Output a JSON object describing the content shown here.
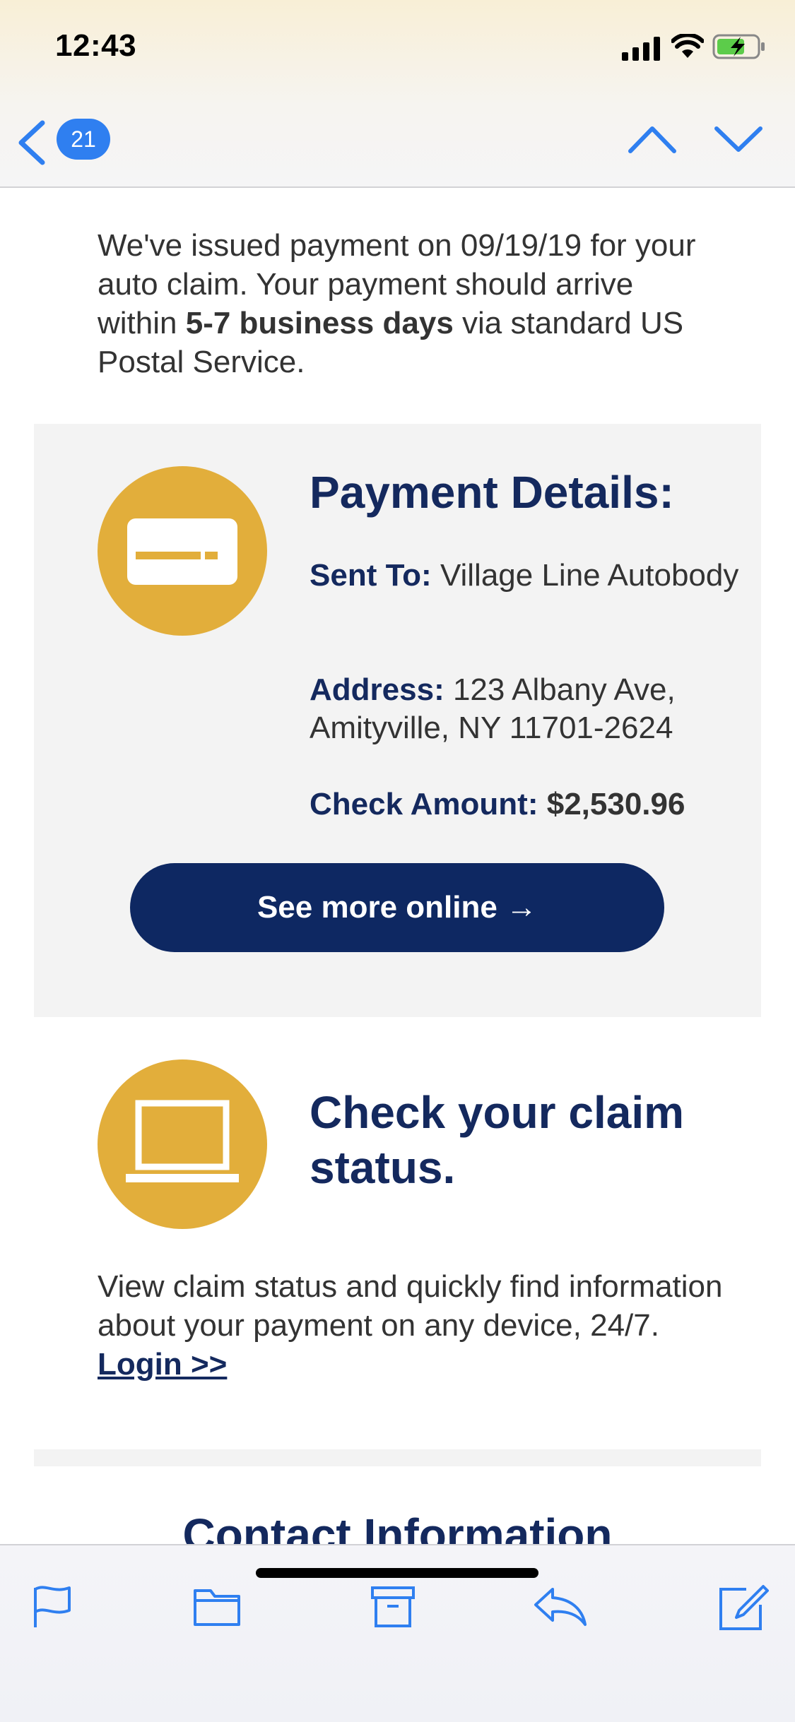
{
  "status_bar": {
    "time": "12:43"
  },
  "nav": {
    "back_count": "21"
  },
  "email": {
    "intro_part1": "We've issued payment on 09/19/19 for your auto claim. Your payment should arrive within ",
    "intro_bold": "5-7 business days",
    "intro_part2": " via standard US Postal Service.",
    "payment_details": {
      "title": "Payment Details:",
      "sent_to_label": "Sent To:",
      "sent_to_value": " Village Line Autobody",
      "address_label": "Address:",
      "address_value": " 123 Albany Ave, Amityville, NY 11701-2624",
      "amount_label": "Check Amount:",
      "amount_value": " $2,530.96",
      "button_label": "See more online →"
    },
    "claim": {
      "title": "Check your claim status.",
      "text": "View claim status and quickly find information about your payment on any device, 24/7. ",
      "login_label": "Login >>"
    },
    "contact_title": "Contact Information"
  },
  "icons": {
    "payment_icon": "credit-card-icon",
    "claim_icon": "laptop-icon",
    "toolbar": [
      "flag-icon",
      "folder-icon",
      "archive-icon",
      "reply-icon",
      "compose-icon"
    ]
  },
  "colors": {
    "accent_blue": "#2f7ff0",
    "navy": "#14295e",
    "button_navy": "#0e2862",
    "gold": "#e2ae3b",
    "panel_gray": "#f3f3f3"
  }
}
